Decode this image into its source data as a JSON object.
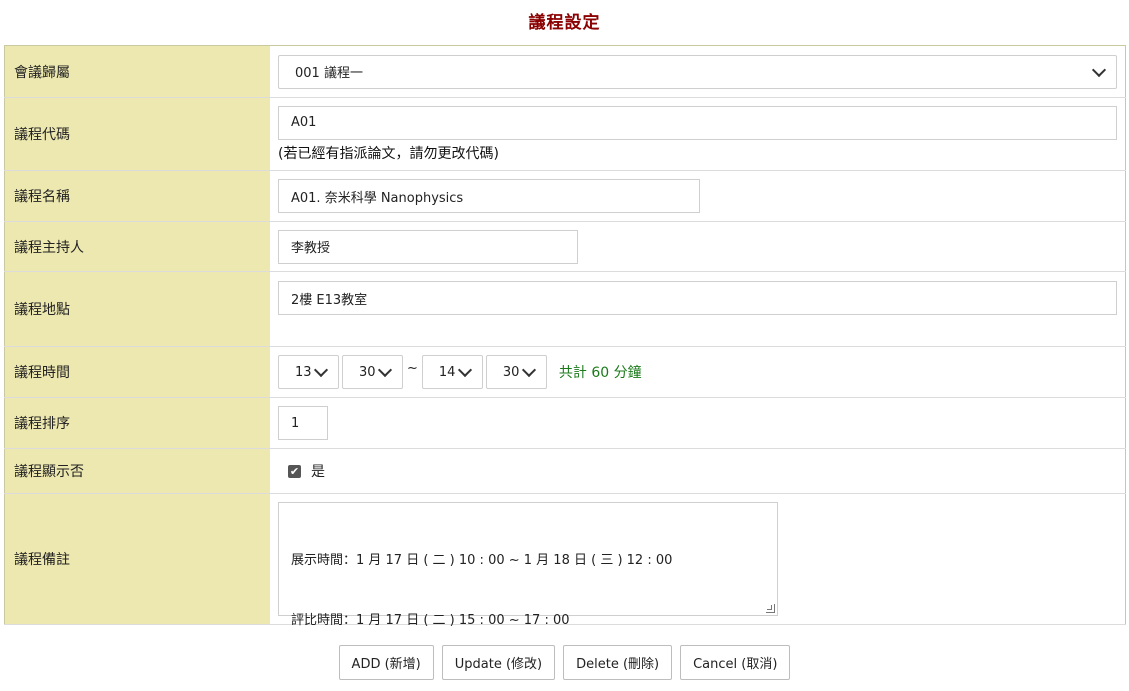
{
  "page_title": "議程設定",
  "fields": {
    "meeting": {
      "label": "會議歸屬",
      "selected": "001 議程一"
    },
    "code": {
      "label": "議程代碼",
      "value": "A01",
      "hint": "(若已經有指派論文，請勿更改代碼)"
    },
    "name": {
      "label": "議程名稱",
      "value": "A01. 奈米科學 Nanophysics"
    },
    "host": {
      "label": "議程主持人",
      "value": "李教授"
    },
    "location": {
      "label": "議程地點",
      "value": "2樓 E13教室"
    },
    "time": {
      "label": "議程時間",
      "start_hour": "13",
      "start_min": "30",
      "separator": "~",
      "end_hour": "14",
      "end_min": "30",
      "total": "共計 60 分鐘"
    },
    "order": {
      "label": "議程排序",
      "value": "1"
    },
    "visible": {
      "label": "議程顯示否",
      "checked": true,
      "check_label": "是"
    },
    "notes": {
      "label": "議程備註",
      "line1": "展示時間：1 月 17 日 ( 二 ) 10 : 00 ~ 1 月 18 日 ( 三 ) 12 : 00",
      "line2": "評比時間：1 月 17 日 ( 二 ) 15 : 00 ~ 17 : 00"
    }
  },
  "buttons": {
    "add": "ADD (新增)",
    "update": "Update (修改)",
    "delete": "Delete (刪除)",
    "cancel": "Cancel (取消)"
  },
  "colors": {
    "title": "#8b0000",
    "label_bg": "#ede8b0",
    "total_text": "#1a7a1a"
  }
}
